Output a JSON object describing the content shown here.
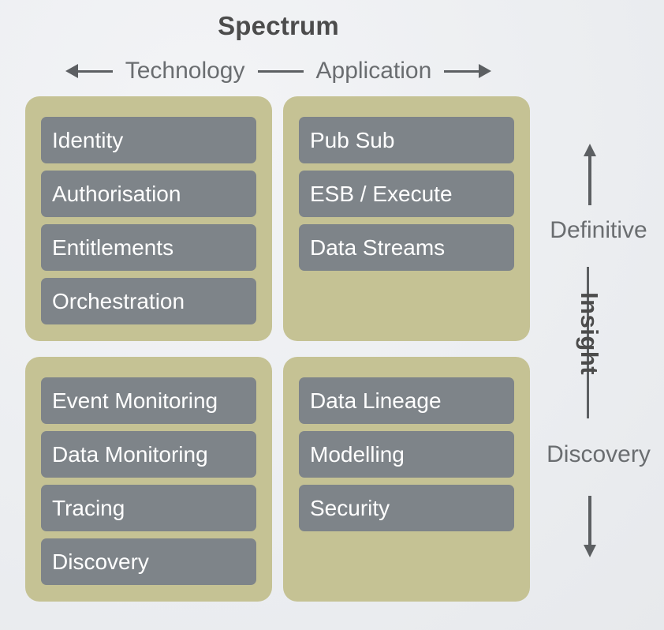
{
  "header": {
    "title": "Spectrum",
    "axis": {
      "left_arrow_icon": "arrow-left-icon",
      "left_label": "Technology",
      "right_label": "Application",
      "right_arrow_icon": "arrow-right-icon"
    }
  },
  "quadrants": [
    {
      "id": "technology-definitive",
      "items": [
        "Identity",
        "Authorisation",
        "Entitlements",
        "Orchestration"
      ]
    },
    {
      "id": "application-definitive",
      "items": [
        "Pub Sub",
        "ESB / Execute",
        "Data Streams"
      ]
    },
    {
      "id": "technology-discovery",
      "items": [
        "Event Monitoring",
        "Data Monitoring",
        "Tracing",
        "Discovery"
      ]
    },
    {
      "id": "application-discovery",
      "items": [
        "Data Lineage",
        "Modelling",
        "Security"
      ]
    }
  ],
  "vertical_axis": {
    "up_arrow_icon": "arrow-up-icon",
    "top_label": "Definitive",
    "middle_label": "Insight",
    "bottom_label": "Discovery",
    "down_arrow_icon": "arrow-down-icon"
  },
  "colors": {
    "background": "#eef0f2",
    "panel": "#c5c294",
    "chip": "#7e8489",
    "chip_text": "#ffffff",
    "title_text": "#4c4c4c",
    "axis_text": "#6a6d70",
    "axis_line": "#5c5f62"
  }
}
